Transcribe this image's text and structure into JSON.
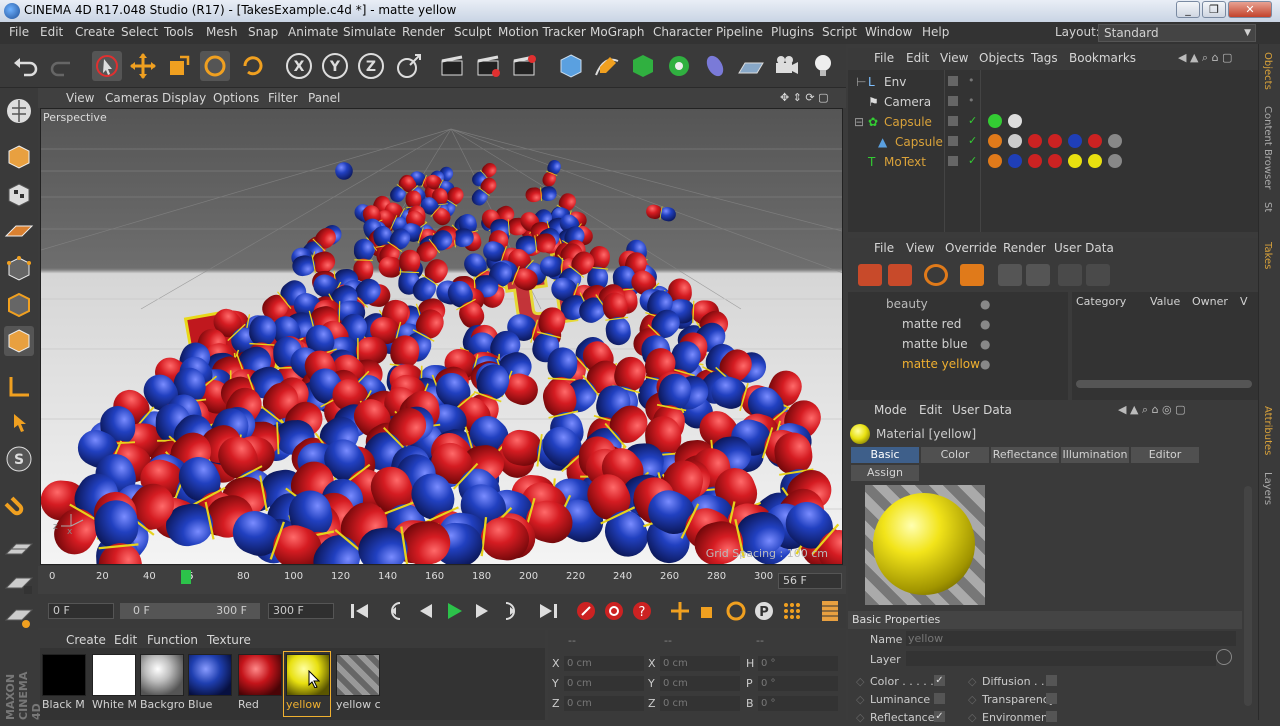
{
  "window": {
    "title": "CINEMA 4D R17.048 Studio (R17) - [TakesExample.c4d *] - matte yellow",
    "buttons": [
      "_",
      "❐",
      "✕"
    ]
  },
  "menubar": {
    "items": [
      "File",
      "Edit",
      "Create",
      "Select",
      "Tools",
      "Mesh",
      "Snap",
      "Animate",
      "Simulate",
      "Render",
      "Sculpt",
      "Motion Tracker",
      "MoGraph",
      "Character",
      "Pipeline",
      "Plugins",
      "Script",
      "Window",
      "Help"
    ],
    "layout_label": "Layout:",
    "layout_value": "Standard"
  },
  "viewport": {
    "menu": [
      "View",
      "Cameras",
      "Display",
      "Options",
      "Filter",
      "Panel"
    ],
    "camera_label": "Perspective",
    "grid_spacing": "Grid Spacing : 100 cm"
  },
  "timeline": {
    "ticks": [
      "0",
      "20",
      "40",
      "56",
      "80",
      "100",
      "120",
      "140",
      "160",
      "180",
      "200",
      "220",
      "240",
      "260",
      "280",
      "300"
    ],
    "current_frame": "56 F",
    "current_marker": 56,
    "start_field": "0 F",
    "range_start": "0 F",
    "range_end": "300 F",
    "end_field": "300 F"
  },
  "material_manager": {
    "menu": [
      "Create",
      "Edit",
      "Function",
      "Texture"
    ],
    "materials": [
      {
        "label": "Black M",
        "color": "#000000"
      },
      {
        "label": "White M",
        "color": "#ffffff"
      },
      {
        "label": "Backgro",
        "color": "#bdbdbd"
      },
      {
        "label": "Blue",
        "color": "#1f3fb0"
      },
      {
        "label": "Red",
        "color": "#c4141a"
      },
      {
        "label": "yellow",
        "color": "#e8e010"
      },
      {
        "label": "yellow c",
        "color": "#777777"
      }
    ],
    "logo": "MAXON CINEMA 4D"
  },
  "coordinates": {
    "header": [
      "--",
      "--",
      "--"
    ],
    "rows": [
      {
        "a": "X",
        "av": "0 cm",
        "b": "X",
        "bv": "0 cm",
        "c": "H",
        "cv": "0 °"
      },
      {
        "a": "Y",
        "av": "0 cm",
        "b": "Y",
        "bv": "0 cm",
        "c": "P",
        "cv": "0 °"
      },
      {
        "a": "Z",
        "av": "0 cm",
        "b": "Z",
        "bv": "0 cm",
        "c": "B",
        "cv": "0 °"
      }
    ]
  },
  "object_manager": {
    "menu": [
      "File",
      "Edit",
      "View",
      "Objects",
      "Tags",
      "Bookmarks"
    ],
    "objects": [
      {
        "name": "Env",
        "color": "#d0d0d0"
      },
      {
        "name": "Camera",
        "color": "#d0d0d0"
      },
      {
        "name": "Capsule",
        "color": "#d9a23a"
      },
      {
        "name": "Capsule",
        "color": "#d9a23a"
      },
      {
        "name": "MoText",
        "color": "#d9a23a"
      }
    ]
  },
  "takes": {
    "menu": [
      "File",
      "View",
      "Override",
      "Render",
      "User Data"
    ],
    "items": [
      {
        "name": "beauty",
        "color": "#bbbbbb"
      },
      {
        "name": "matte red",
        "color": "#cccccc"
      },
      {
        "name": "matte blue",
        "color": "#cccccc"
      },
      {
        "name": "matte yellow",
        "color": "#f0b030"
      }
    ],
    "columns": [
      "Category",
      "Value",
      "Owner",
      "V"
    ]
  },
  "attributes": {
    "menu": [
      "Mode",
      "Edit",
      "User Data"
    ],
    "title": "Material [yellow]",
    "tabs": [
      "Basic",
      "Color",
      "Reflectance",
      "Illumination",
      "Editor"
    ],
    "assign_tab": "Assign",
    "section": "Basic Properties",
    "name_label": "Name",
    "name_value": "yellow",
    "layer_label": "Layer",
    "checks": [
      {
        "label": "Color . . . . .",
        "on": true
      },
      {
        "label": "Diffusion . . .",
        "on": false
      },
      {
        "label": "Luminance",
        "on": false
      },
      {
        "label": "Transparency",
        "on": false
      },
      {
        "label": "Reflectance",
        "on": true
      },
      {
        "label": "Environment",
        "on": false
      }
    ]
  },
  "side_tabs": [
    "Objects",
    "Content Browser",
    "St",
    "Takes",
    "Attributes",
    "Layers"
  ],
  "colors": {
    "accent": "#d9a23a",
    "selected": "#3e5f8a",
    "capsule_red": "#d21c22",
    "capsule_blue": "#1f3fb8",
    "text_yellow": "#e6d21c"
  }
}
